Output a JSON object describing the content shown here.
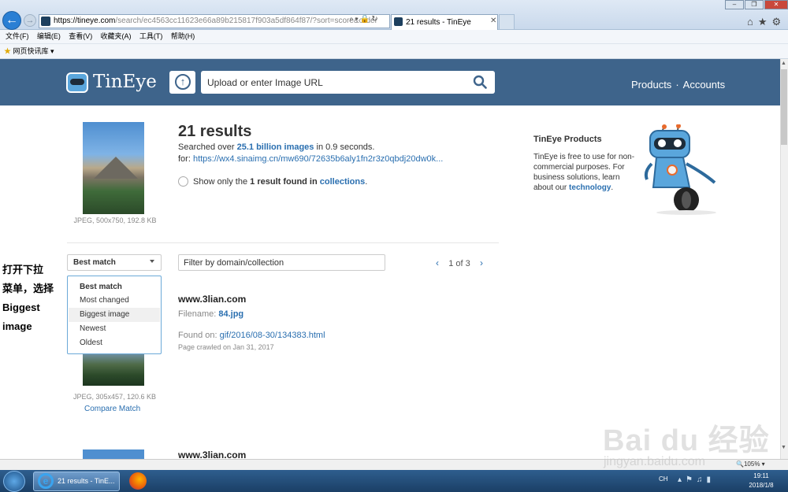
{
  "browser": {
    "address": "https://tineye.com/search/ec4563cc11623e66a89b215817f903a5df864f87/?sort=score&order",
    "address_host": "https://tineye.com",
    "address_path": "/search/ec4563cc11623e66a89b215817f903a5df864f87/?sort=score&order",
    "tab_title": "21 results - TinEye",
    "menu": [
      "文件(F)",
      "编辑(E)",
      "查看(V)",
      "收藏夹(A)",
      "工具(T)",
      "帮助(H)"
    ],
    "favorites_item": "网页快讯库 ▾",
    "zoom": "105%"
  },
  "header": {
    "logo": "TinEye",
    "upload_placeholder": "Upload or enter Image URL",
    "nav_products": "Products",
    "nav_sep": "·",
    "nav_accounts": "Accounts"
  },
  "query": {
    "thumb_meta": "JPEG, 500x750, 192.8 KB",
    "count": "21 results",
    "searched_pre": "Searched over ",
    "searched_num": "25.1 billion images",
    "searched_post": " in 0.9 seconds.",
    "for_label": "for: ",
    "for_url": "https://wx4.sinaimg.cn/mw690/72635b6aly1fn2r3z0qbdj20dw0k...",
    "show_only_pre": "Show only the ",
    "show_only_bold": "1 result found in",
    "show_only_link": "collections",
    "show_only_post": "."
  },
  "side": {
    "title": "TinEye Products",
    "text_pre": "TinEye is free to use for non-commercial purposes. For business solutions, learn about our ",
    "text_link": "technology",
    "text_post": "."
  },
  "controls": {
    "sort_value": "Best match",
    "filter_placeholder": "Filter by domain/collection",
    "page_current": "1",
    "page_of": "of",
    "page_total": "3",
    "prev": "‹",
    "next": "›",
    "sort_options": [
      "Best match",
      "Most changed",
      "Biggest image",
      "Newest",
      "Oldest"
    ]
  },
  "annotation": [
    "打开下拉",
    "菜单，选择",
    "Biggest",
    "image"
  ],
  "results": [
    {
      "domain": "www.3lian.com",
      "filename_label": "Filename: ",
      "filename": "84.jpg",
      "found_label": "Found on: ",
      "found": "gif/2016/08-30/134383.html",
      "crawled": "Page crawled on Jan 31, 2017",
      "thumb_meta": "JPEG, 305x457, 120.6 KB",
      "compare": "Compare Match"
    },
    {
      "domain": "www.3lian.com"
    }
  ],
  "taskbar": {
    "ie_item": "21 results - TinE...",
    "lang": "CH",
    "time": "19:11",
    "date": "2018/1/8"
  },
  "watermark": {
    "main": "Bai du 经验",
    "sub": "jingyan.baidu.com"
  }
}
